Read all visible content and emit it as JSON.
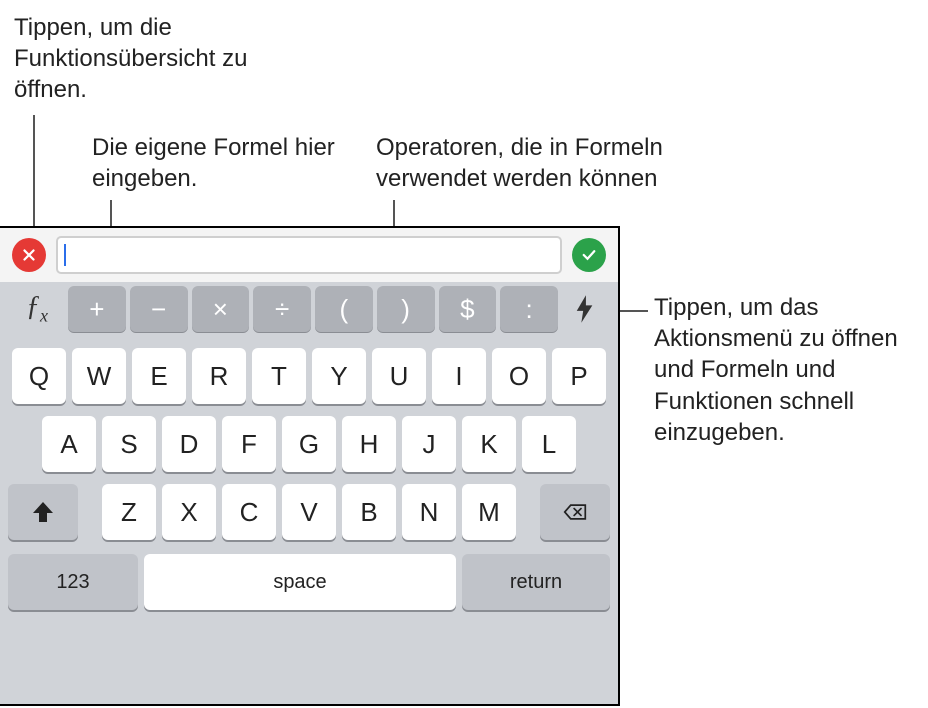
{
  "callouts": {
    "fx": "Tippen, um die Funktionsübersicht zu öffnen.",
    "input": "Die eigene Formel hier eingeben.",
    "ops": "Operatoren, die in Formeln verwendet werden können",
    "bolt": "Tippen, um das Aktionsmenü zu öffnen und Formeln und Funktionen schnell einzugeben."
  },
  "formula_value": "",
  "fx_label": "ƒx",
  "operators": [
    "+",
    "−",
    "×",
    "÷",
    "(",
    ")",
    "$",
    ":"
  ],
  "rows": {
    "r1": [
      "Q",
      "W",
      "E",
      "R",
      "T",
      "Y",
      "U",
      "I",
      "O",
      "P"
    ],
    "r2": [
      "A",
      "S",
      "D",
      "F",
      "G",
      "H",
      "J",
      "K",
      "L"
    ],
    "r3": [
      "Z",
      "X",
      "C",
      "V",
      "B",
      "N",
      "M"
    ]
  },
  "keys": {
    "numbers": "123",
    "space": "space",
    "return": "return"
  }
}
